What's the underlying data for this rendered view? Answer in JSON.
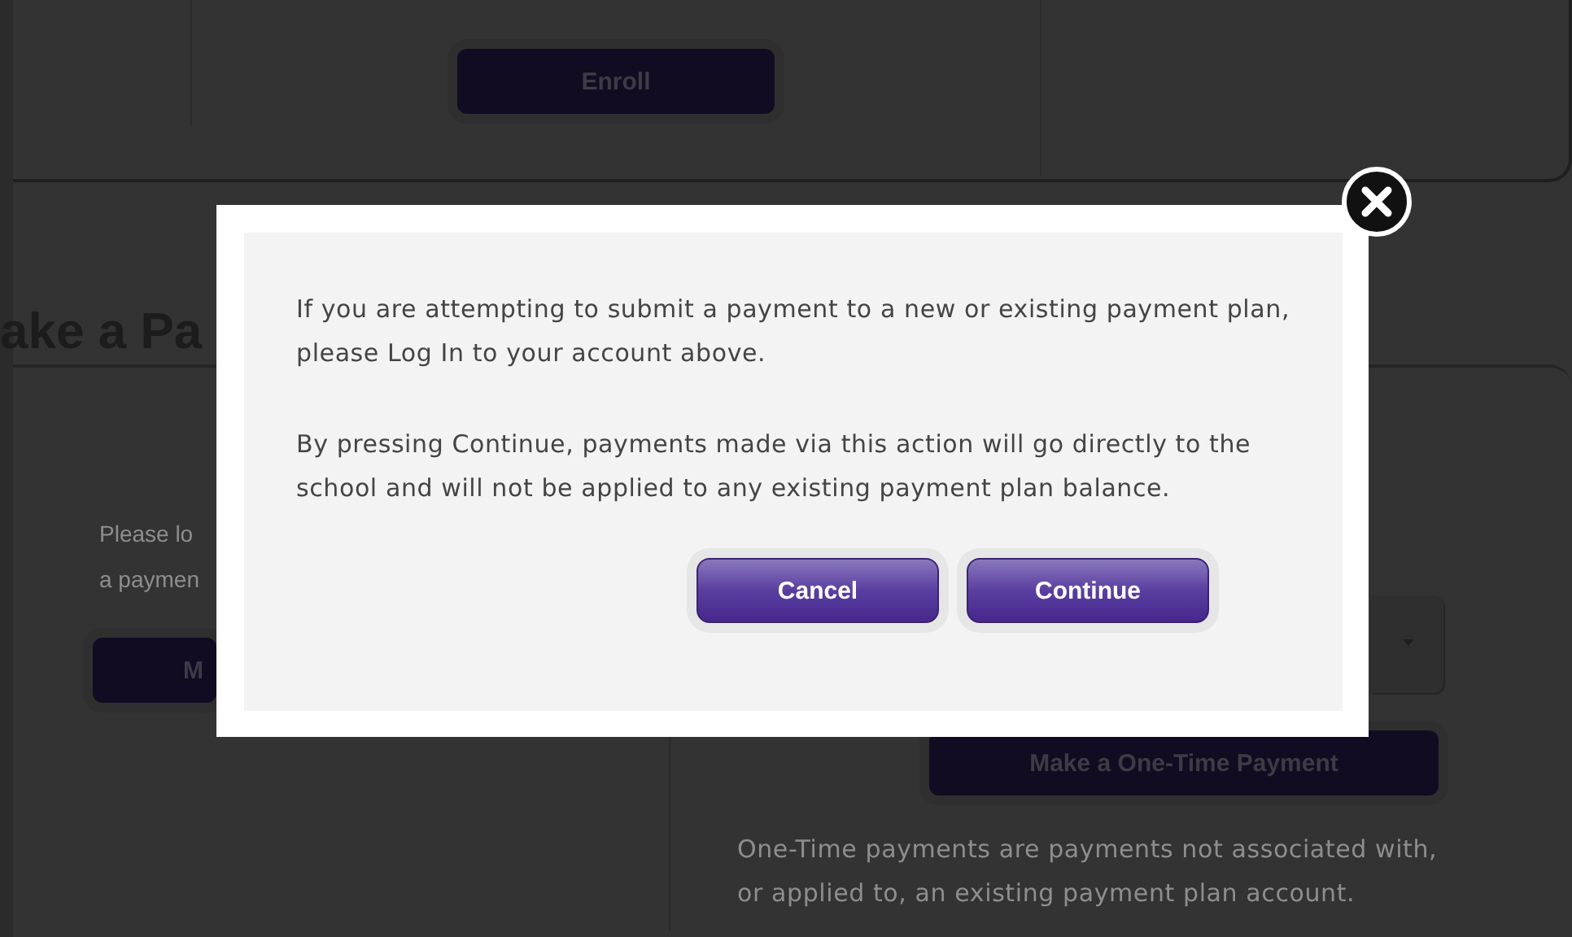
{
  "page": {
    "enroll_button": "Enroll",
    "heading": "ake a Pa",
    "left_text_lines": [
      "Please lo",
      "a paymen"
    ],
    "left_button": "M",
    "one_time_button": "Make a One-Time Payment",
    "one_time_note": "One-Time payments are payments not associated with, or applied to, an existing payment plan account."
  },
  "dialog": {
    "paragraphs": [
      "If you are attempting to submit a payment to a new or existing payment plan, please Log In to your account above.",
      "By pressing Continue, payments made via this action will go directly to the school and will not be applied to any existing payment plan balance."
    ],
    "buttons": [
      "Cancel",
      "Continue"
    ]
  }
}
